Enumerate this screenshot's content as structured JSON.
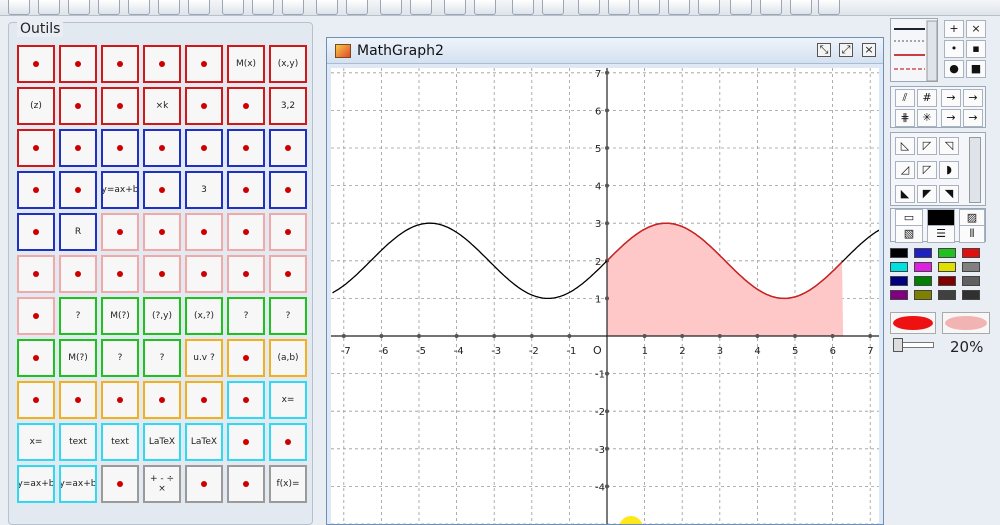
{
  "window": {
    "title": "MathGraph2"
  },
  "tools_panel": {
    "title": "Outils"
  },
  "tools": [
    {
      "label": "",
      "color": "red"
    },
    {
      "label": "",
      "color": "red"
    },
    {
      "label": "",
      "color": "red"
    },
    {
      "label": "",
      "color": "red"
    },
    {
      "label": "",
      "color": "red"
    },
    {
      "label": "M(x)",
      "color": "red"
    },
    {
      "label": "(x,y)",
      "color": "red"
    },
    {
      "label": "(z)",
      "color": "red"
    },
    {
      "label": "",
      "color": "red"
    },
    {
      "label": "",
      "color": "red"
    },
    {
      "label": "×k",
      "color": "red"
    },
    {
      "label": "",
      "color": "red"
    },
    {
      "label": "",
      "color": "red"
    },
    {
      "label": "3,2",
      "color": "red"
    },
    {
      "label": "",
      "color": "red"
    },
    {
      "label": "",
      "color": "blue"
    },
    {
      "label": "",
      "color": "blue"
    },
    {
      "label": "",
      "color": "blue"
    },
    {
      "label": "",
      "color": "blue"
    },
    {
      "label": "",
      "color": "blue"
    },
    {
      "label": "",
      "color": "blue"
    },
    {
      "label": "",
      "color": "blue"
    },
    {
      "label": "",
      "color": "blue"
    },
    {
      "label": "y=ax+b",
      "color": "blue"
    },
    {
      "label": "",
      "color": "blue"
    },
    {
      "label": "3",
      "color": "blue"
    },
    {
      "label": "",
      "color": "blue"
    },
    {
      "label": "",
      "color": "blue"
    },
    {
      "label": "",
      "color": "blue"
    },
    {
      "label": "R",
      "color": "blue"
    },
    {
      "label": "",
      "color": "pink"
    },
    {
      "label": "",
      "color": "pink"
    },
    {
      "label": "",
      "color": "pink"
    },
    {
      "label": "",
      "color": "pink"
    },
    {
      "label": "",
      "color": "pink"
    },
    {
      "label": "",
      "color": "pink"
    },
    {
      "label": "",
      "color": "pink"
    },
    {
      "label": "",
      "color": "pink"
    },
    {
      "label": "",
      "color": "pink"
    },
    {
      "label": "",
      "color": "pink"
    },
    {
      "label": "",
      "color": "pink"
    },
    {
      "label": "",
      "color": "pink"
    },
    {
      "label": "",
      "color": "pink"
    },
    {
      "label": "?",
      "color": "green"
    },
    {
      "label": "M(?)",
      "color": "green"
    },
    {
      "label": "(?,y)",
      "color": "green"
    },
    {
      "label": "(x,?)",
      "color": "green"
    },
    {
      "label": "?",
      "color": "green"
    },
    {
      "label": "?",
      "color": "green"
    },
    {
      "label": "",
      "color": "green"
    },
    {
      "label": "M(?)",
      "color": "green"
    },
    {
      "label": "?",
      "color": "green"
    },
    {
      "label": "?",
      "color": "green"
    },
    {
      "label": "u.v ?",
      "color": "orange"
    },
    {
      "label": "",
      "color": "orange"
    },
    {
      "label": "(a,b)",
      "color": "orange"
    },
    {
      "label": "",
      "color": "orange"
    },
    {
      "label": "",
      "color": "orange"
    },
    {
      "label": "",
      "color": "orange"
    },
    {
      "label": "",
      "color": "orange"
    },
    {
      "label": "",
      "color": "orange"
    },
    {
      "label": "",
      "color": "cyan"
    },
    {
      "label": "x=",
      "color": "cyan"
    },
    {
      "label": "x=",
      "color": "cyan"
    },
    {
      "label": "text",
      "color": "cyan"
    },
    {
      "label": "text",
      "color": "cyan"
    },
    {
      "label": "LaTeX",
      "color": "cyan"
    },
    {
      "label": "LaTeX",
      "color": "cyan"
    },
    {
      "label": "",
      "color": "cyan"
    },
    {
      "label": "",
      "color": "cyan"
    },
    {
      "label": "y=ax+b",
      "color": "cyan"
    },
    {
      "label": "y=ax+b",
      "color": "cyan"
    },
    {
      "label": "",
      "color": "gray"
    },
    {
      "label": "+ - ÷ ×",
      "color": "gray"
    },
    {
      "label": "",
      "color": "gray"
    },
    {
      "label": "",
      "color": "gray"
    },
    {
      "label": "f(x)=",
      "color": "gray"
    }
  ],
  "right_panel": {
    "buttons_top": [
      "+",
      "×",
      "•",
      "▪",
      "●",
      "■"
    ],
    "arrows": [
      "→",
      "→",
      "→",
      "→"
    ],
    "colors": [
      "#000000",
      "#2020c0",
      "#20c020",
      "#e01010",
      "#00e0e0",
      "#e020e0",
      "#e0e000",
      "#808080",
      "#000080",
      "#008000",
      "#800000",
      "#606060",
      "#800080",
      "#808000",
      "#404040",
      "#303030"
    ],
    "fill_accent": "#ee1111",
    "fill_soft": "#f2b3b3",
    "zoom": "20%"
  },
  "chart_data": {
    "type": "line",
    "title": "",
    "xlabel": "",
    "ylabel": "",
    "origin_label": "O",
    "xlim": [
      -7.3,
      7.3
    ],
    "ylim": [
      -5,
      7
    ],
    "x_ticks": [
      -7,
      -6,
      -5,
      -4,
      -3,
      -2,
      -1,
      1,
      2,
      3,
      4,
      5,
      6,
      7
    ],
    "y_ticks": [
      -4,
      -3,
      -2,
      -1,
      1,
      2,
      3,
      4,
      5,
      6,
      7
    ],
    "grid": true,
    "series": [
      {
        "function": "2 + sin(x)",
        "x_range": [
          -7.3,
          7.3
        ],
        "color": "#000000"
      },
      {
        "function": "2 + sin(x)",
        "x_range": [
          0,
          6.28
        ],
        "color": "#d42020",
        "fill_to_axis": true,
        "fill_color": "#ffc8c8"
      }
    ]
  }
}
